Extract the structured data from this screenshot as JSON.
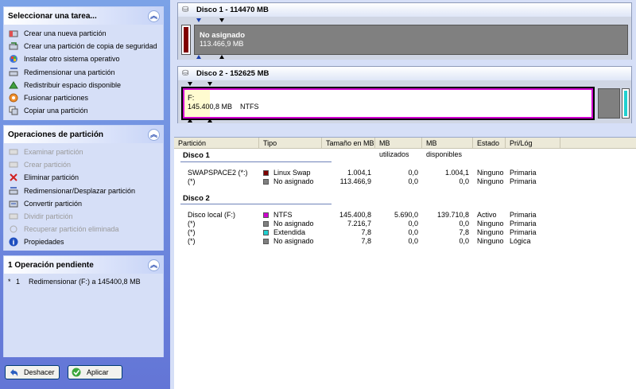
{
  "colors": {
    "linux_swap": "#800000",
    "unallocated": "#808080",
    "ntfs": "#d000d0",
    "extended": "#20d0d0",
    "selected_frame": "#000000"
  },
  "tasks_panel": {
    "title": "Seleccionar una tarea...",
    "items": [
      {
        "label": "Crear una nueva partición",
        "icon": "new-partition-icon"
      },
      {
        "label": "Crear una partición de copia de seguridad",
        "icon": "backup-partition-icon"
      },
      {
        "label": "Instalar otro sistema operativo",
        "icon": "install-os-icon"
      },
      {
        "label": "Redimensionar una partición",
        "icon": "resize-icon"
      },
      {
        "label": "Redistribuir espacio disponible",
        "icon": "redistribute-icon"
      },
      {
        "label": "Fusionar particiones",
        "icon": "merge-icon"
      },
      {
        "label": "Copiar una partición",
        "icon": "copy-icon"
      }
    ]
  },
  "operations_panel": {
    "title": "Operaciones de partición",
    "items": [
      {
        "label": "Examinar partición",
        "enabled": false
      },
      {
        "label": "Crear partición",
        "enabled": false
      },
      {
        "label": "Eliminar partición",
        "enabled": true
      },
      {
        "label": "Redimensionar/Desplazar partición",
        "enabled": true
      },
      {
        "label": "Convertir partición",
        "enabled": true
      },
      {
        "label": "Dividir partición",
        "enabled": false
      },
      {
        "label": "Recuperar partición eliminada",
        "enabled": false
      },
      {
        "label": "Propiedades",
        "enabled": true
      }
    ]
  },
  "pending_panel": {
    "title": "1 Operación pendiente",
    "items": [
      {
        "marker": "*",
        "number": "1",
        "text": "Redimensionar (F:) a 145400,8 MB"
      }
    ]
  },
  "buttons": {
    "undo_label": "Deshacer",
    "apply_label": "Aplicar"
  },
  "disk1": {
    "title": "Disco 1 - 114470 MB",
    "main_partition": {
      "name": "No asignado",
      "size": "113.466,9 MB"
    }
  },
  "disk2": {
    "title": "Disco 2 - 152625 MB",
    "main_partition": {
      "drive": "F:",
      "size": "145.400,8 MB",
      "fs": "NTFS"
    }
  },
  "table": {
    "columns": [
      "Partición",
      "Tipo",
      "Tamaño en MB",
      "MB utilizados",
      "MB disponibles",
      "Estado",
      "Pri/Lóg"
    ],
    "groups": [
      {
        "title": "Disco 1",
        "rows": [
          {
            "partition": "SWAPSPACE2 (*:)",
            "type": "Linux Swap",
            "type_color": "#800000",
            "size": "1.004,1",
            "used": "0,0",
            "free": "1.004,1",
            "status": "Ninguno",
            "prilog": "Primaria"
          },
          {
            "partition": "(*)",
            "type": "No asignado",
            "type_color": "#808080",
            "size": "113.466,9",
            "used": "0,0",
            "free": "0,0",
            "status": "Ninguno",
            "prilog": "Primaria"
          }
        ]
      },
      {
        "title": "Disco 2",
        "rows": [
          {
            "partition": "Disco local (F:)",
            "type": "NTFS",
            "type_color": "#d000d0",
            "size": "145.400,8",
            "used": "5.690,0",
            "free": "139.710,8",
            "status": "Activo",
            "prilog": "Primaria"
          },
          {
            "partition": "(*)",
            "type": "No asignado",
            "type_color": "#808080",
            "size": "7.216,7",
            "used": "0,0",
            "free": "0,0",
            "status": "Ninguno",
            "prilog": "Primaria"
          },
          {
            "partition": "(*)",
            "type": "Extendida",
            "type_color": "#20d0d0",
            "size": "7,8",
            "used": "0,0",
            "free": "7,8",
            "status": "Ninguno",
            "prilog": "Primaria"
          },
          {
            "partition": "(*)",
            "type": "No asignado",
            "type_color": "#808080",
            "size": "7,8",
            "used": "0,0",
            "free": "0,0",
            "status": "Ninguno",
            "prilog": "Lógica"
          }
        ]
      }
    ]
  }
}
